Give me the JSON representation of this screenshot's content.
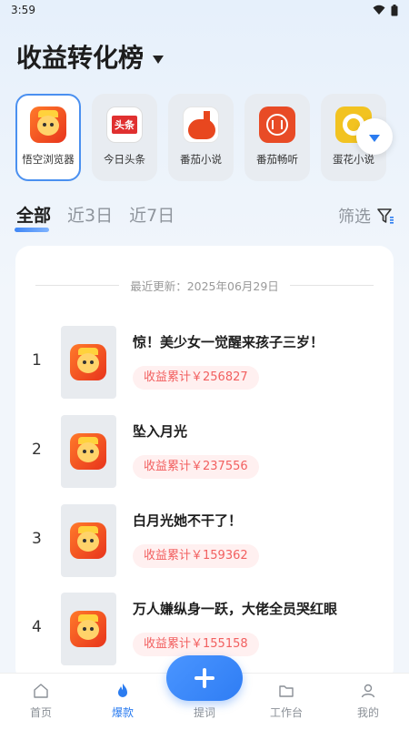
{
  "status_bar": {
    "time": "3:59",
    "icons": [
      "wifi-icon",
      "battery-icon"
    ]
  },
  "header": {
    "title": "收益转化榜",
    "dropdown_icon": "chevron-down-icon"
  },
  "apps": [
    {
      "label": "悟空浏览器",
      "icon": "wukong-app-icon",
      "selected": true
    },
    {
      "label": "今日头条",
      "icon": "toutiao-app-icon",
      "selected": false
    },
    {
      "label": "番茄小说",
      "icon": "fanqie-novel-app-icon",
      "selected": false
    },
    {
      "label": "番茄畅听",
      "icon": "fanqie-listen-app-icon",
      "selected": false
    },
    {
      "label": "蛋花小说",
      "icon": "danhua-novel-app-icon",
      "selected": false
    }
  ],
  "toutiao_badge": "头条",
  "tabs": [
    {
      "label": "全部",
      "active": true
    },
    {
      "label": "近3日",
      "active": false
    },
    {
      "label": "近7日",
      "active": false
    }
  ],
  "filter": {
    "label": "筛选",
    "icon": "filter-icon"
  },
  "update": {
    "text": "最近更新：2025年06月29日"
  },
  "ranking": [
    {
      "rank": "1",
      "title": "惊！美少女一觉醒来孩子三岁！",
      "earnings": "收益累计￥256827"
    },
    {
      "rank": "2",
      "title": "坠入月光",
      "earnings": "收益累计￥237556"
    },
    {
      "rank": "3",
      "title": "白月光她不干了！",
      "earnings": "收益累计￥159362"
    },
    {
      "rank": "4",
      "title": "万人嫌纵身一跃，大佬全员哭红眼",
      "earnings": "收益累计￥155158"
    }
  ],
  "bottom_nav": [
    {
      "label": "首页",
      "icon": "home-icon",
      "active": false
    },
    {
      "label": "爆款",
      "icon": "flame-icon",
      "active": true
    },
    {
      "label": "提词",
      "icon": "",
      "active": false
    },
    {
      "label": "工作台",
      "icon": "folder-icon",
      "active": false
    },
    {
      "label": "我的",
      "icon": "user-icon",
      "active": false
    }
  ],
  "colors": {
    "accent": "#2b7cf0",
    "earnings_text": "#f26060",
    "earnings_bg": "#fff0f0",
    "page_bg": "#f2f6fb"
  }
}
